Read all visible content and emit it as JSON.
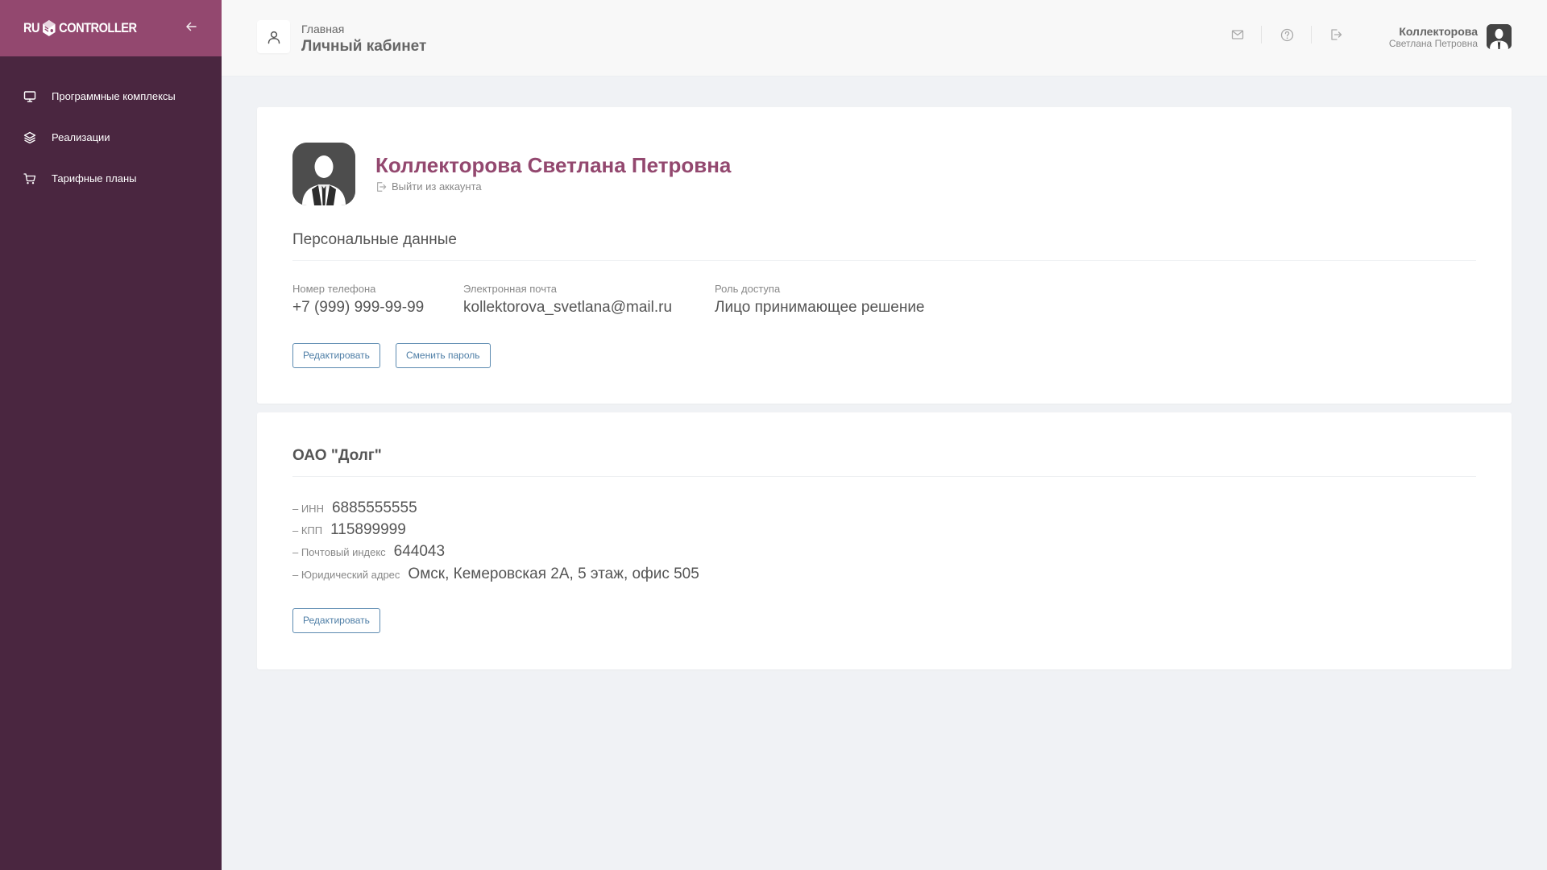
{
  "sidebar": {
    "logo": {
      "left": "RU",
      "right": "CONTROLLER"
    },
    "items": [
      {
        "label": "Программные комплексы",
        "icon": "monitor-icon"
      },
      {
        "label": "Реализации",
        "icon": "layers-icon"
      },
      {
        "label": "Тарифные планы",
        "icon": "cart-icon"
      }
    ],
    "colors": {
      "background": "#4a2640",
      "brand": "#93486f"
    }
  },
  "header": {
    "breadcrumb": "Главная",
    "title": "Личный кабинет",
    "actions": [
      "mail-icon",
      "help-icon",
      "logout-icon"
    ],
    "user": {
      "surname": "Коллекторова",
      "given_names": "Светлана Петровна"
    }
  },
  "profile": {
    "full_name": "Коллекторова Светлана Петровна",
    "logout_label": "Выйти из аккаунта",
    "section_title": "Персональные данные",
    "fields": [
      {
        "label": "Номер телефона",
        "value": "+7 (999) 999-99-99"
      },
      {
        "label": "Электронная почта",
        "value": "kollektorova_svetlana@mail.ru"
      },
      {
        "label": "Роль доступа",
        "value": "Лицо принимающее решение"
      }
    ],
    "edit_label": "Редактировать",
    "change_password_label": "Сменить пароль"
  },
  "company": {
    "name": "ОАО \"Долг\"",
    "details": [
      {
        "label": "– ИНН",
        "value": "6885555555"
      },
      {
        "label": "– КПП",
        "value": "115899999"
      },
      {
        "label": "– Почтовый индекс",
        "value": "644043"
      },
      {
        "label": "– Юридический адрес",
        "value": "Омск, Кемеровская 2А, 5 этаж, офис 505"
      }
    ],
    "edit_label": "Редактировать"
  },
  "colors": {
    "accent": "#93486f",
    "button": "#4e7ea6",
    "page_bg": "#f0f2f5"
  }
}
